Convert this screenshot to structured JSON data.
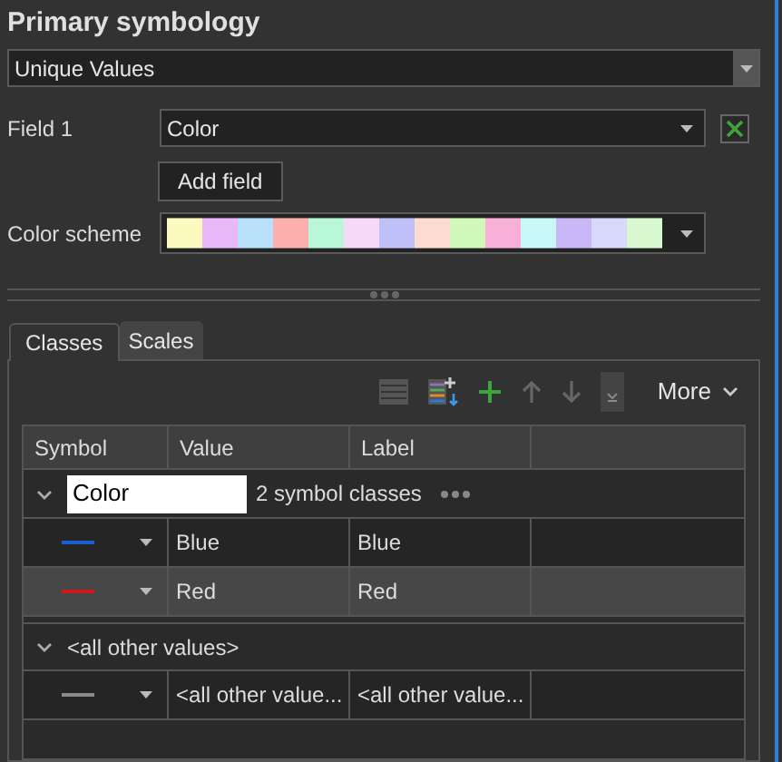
{
  "title": "Primary symbology",
  "renderer": {
    "value": "Unique Values"
  },
  "field_1": {
    "label": "Field 1",
    "value": "Color"
  },
  "add_field_button": "Add field",
  "color_scheme": {
    "label": "Color scheme"
  },
  "tabs": [
    {
      "label": "Classes",
      "selected": true
    },
    {
      "label": "Scales",
      "selected": false
    }
  ],
  "toolbar": {
    "more": "More"
  },
  "table": {
    "columns": [
      "Symbol",
      "Value",
      "Label"
    ],
    "groups": [
      {
        "kind": "field",
        "heading": "Color",
        "count": "2 symbol classes",
        "expanded": true,
        "rows": [
          {
            "value": "Blue",
            "label": "Blue",
            "color": "#1a5fd0",
            "selected": false
          },
          {
            "value": "Red",
            "label": "Red",
            "color": "#d01818",
            "selected": true
          }
        ]
      },
      {
        "kind": "other",
        "heading": "<all other values>",
        "expanded": true,
        "rows": [
          {
            "value": "<all other value...",
            "label": "<all other value...",
            "color": "#8a8a8a",
            "selected": false
          }
        ]
      }
    ]
  }
}
